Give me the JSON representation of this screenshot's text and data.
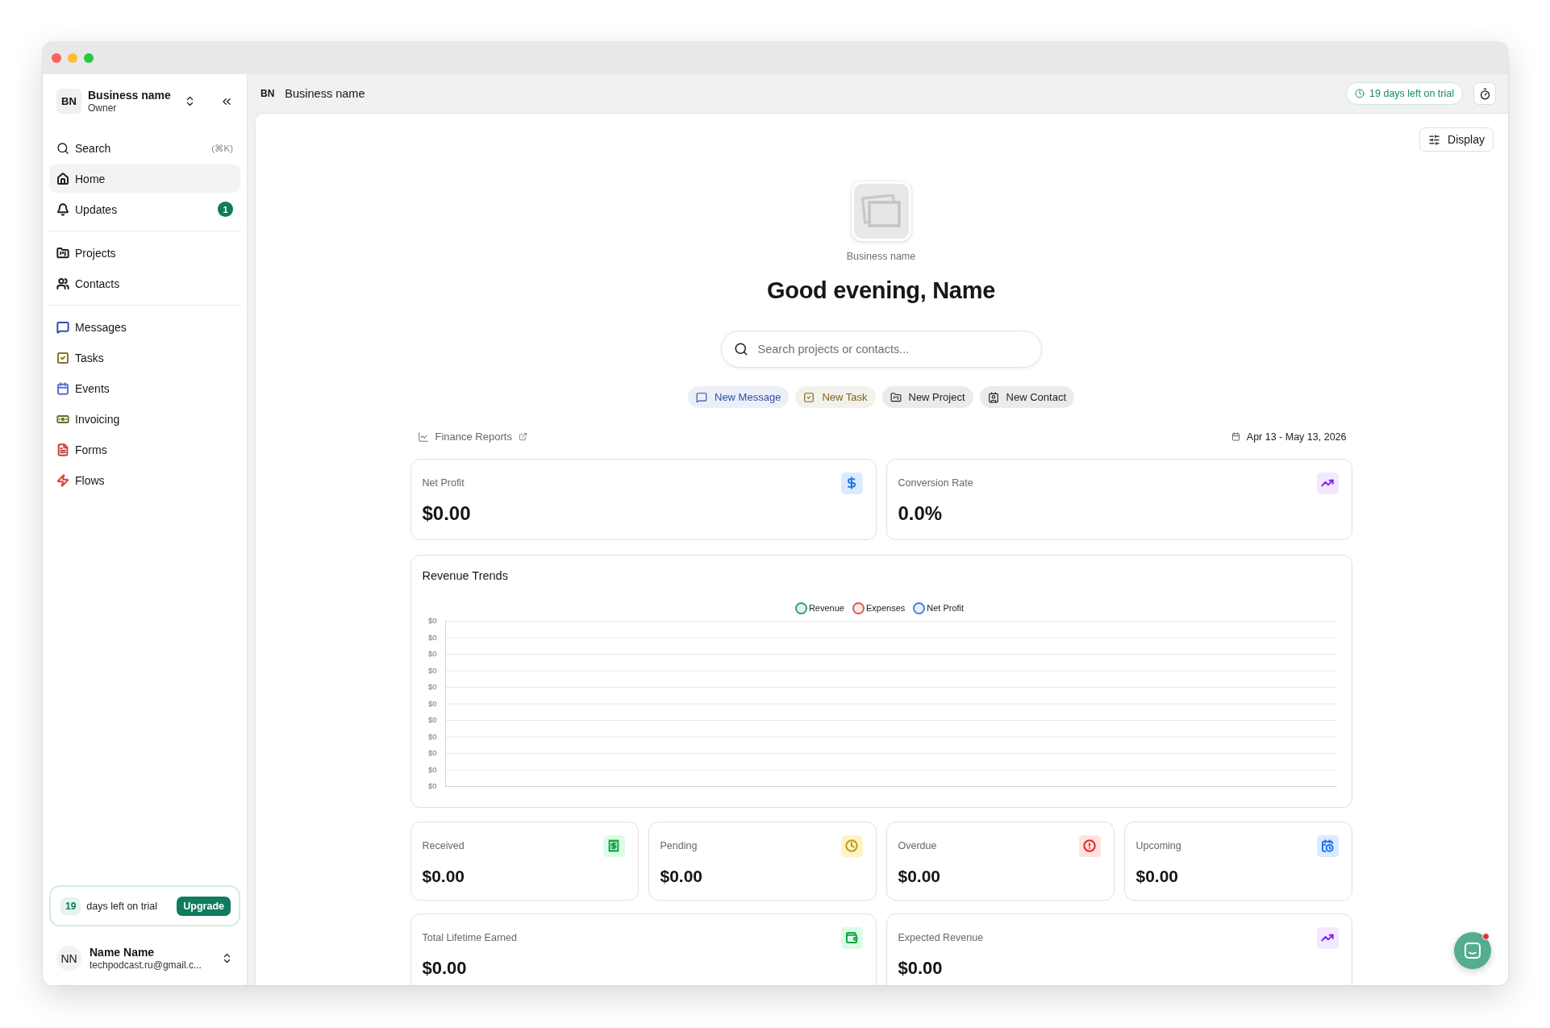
{
  "sidebar": {
    "business": {
      "initials": "BN",
      "name": "Business name",
      "role": "Owner"
    },
    "search": {
      "label": "Search",
      "shortcut": "(⌘K)"
    },
    "nav_groups": [
      {
        "items": [
          {
            "label": "Home",
            "selected": true,
            "color": "#1f1f1f"
          },
          {
            "label": "Updates",
            "selected": false,
            "badge": "1",
            "color": "#1f1f1f"
          }
        ]
      },
      {
        "items": [
          {
            "label": "Projects",
            "selected": false,
            "color": "#1f1f1f"
          },
          {
            "label": "Contacts",
            "selected": false,
            "color": "#1f1f1f"
          }
        ]
      },
      {
        "items": [
          {
            "label": "Messages",
            "selected": false,
            "color": "#2f4fb0"
          },
          {
            "label": "Tasks",
            "selected": false,
            "color": "#8a7424"
          },
          {
            "label": "Events",
            "selected": false,
            "color": "#5b6fd6"
          },
          {
            "label": "Invoicing",
            "selected": false,
            "color": "#6e6b2c"
          },
          {
            "label": "Forms",
            "selected": false,
            "color": "#c2453f"
          },
          {
            "label": "Flows",
            "selected": false,
            "color": "#d9472f"
          }
        ]
      }
    ],
    "trial": {
      "days": "19",
      "text": "days left on trial",
      "button": "Upgrade"
    },
    "user": {
      "initials": "NN",
      "name": "Name Name",
      "email": "techpodcast.ru@gmail.c..."
    }
  },
  "header": {
    "initials": "BN",
    "title": "Business name",
    "trial_badge": "19 days left on trial"
  },
  "toolbar": {
    "display_button": "Display"
  },
  "profile": {
    "caption": "Business name",
    "greeting": "Good evening, Name"
  },
  "search": {
    "placeholder": "Search projects or contacts..."
  },
  "quick_actions": [
    {
      "label": "New Message",
      "color": "#2f4fa8"
    },
    {
      "label": "New Task",
      "color": "#7a6520"
    },
    {
      "label": "New Project",
      "color": "#1f1f1f"
    },
    {
      "label": "New Contact",
      "color": "#1f1f1f"
    }
  ],
  "reports": {
    "link": "Finance Reports",
    "date_range": "Apr 13 - May 13, 2026"
  },
  "summary_cards": [
    {
      "label": "Net Profit",
      "value": "$0.00",
      "color": "#dbeafe"
    },
    {
      "label": "Conversion Rate",
      "value": "0.0%",
      "color": "#f3e8ff"
    }
  ],
  "revenue_trends": {
    "title": "Revenue Trends",
    "legend": [
      {
        "label": "Revenue",
        "color": "#2fa36b"
      },
      {
        "label": "Expenses",
        "color": "#e0574a"
      },
      {
        "label": "Net Profit",
        "color": "#4a7fe0"
      }
    ],
    "y_labels": [
      "$0",
      "$0",
      "$0",
      "$0",
      "$0",
      "$0",
      "$0",
      "$0",
      "$0",
      "$0",
      "$0"
    ]
  },
  "invoice_cards": [
    {
      "label": "Received",
      "value": "$0.00",
      "color": "#dcfce7"
    },
    {
      "label": "Pending",
      "value": "$0.00",
      "color": "#fef3c7"
    },
    {
      "label": "Overdue",
      "value": "$0.00",
      "color": "#fee2e2"
    },
    {
      "label": "Upcoming",
      "value": "$0.00",
      "color": "#dbeafe"
    }
  ],
  "lifetime_cards": [
    {
      "label": "Total Lifetime Earned",
      "value": "$0.00",
      "color": "#dcfce7"
    },
    {
      "label": "Expected Revenue",
      "value": "$0.00",
      "color": "#f3e8ff"
    }
  ]
}
